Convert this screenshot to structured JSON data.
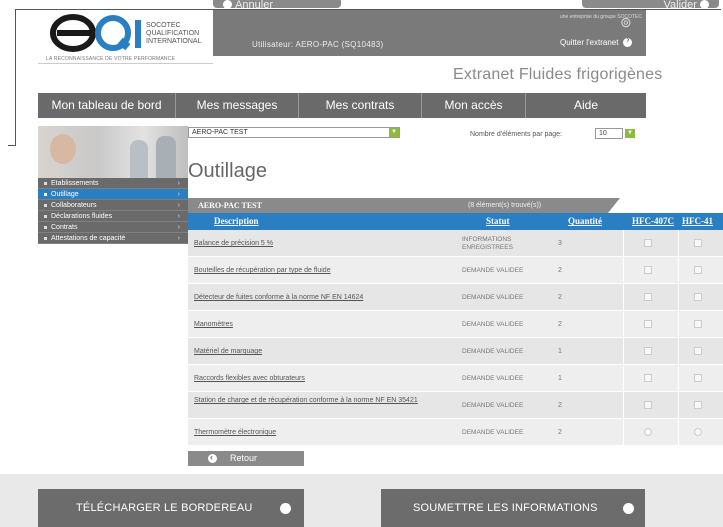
{
  "top_buttons": {
    "cancel_label": "Annuler",
    "validate_label": "Valider"
  },
  "header": {
    "logo_text": [
      "SOCOTEC",
      "QUALIFICATION",
      "INTERNATIONAL"
    ],
    "tagline": "LA RECONNAISSANCE DE VOTRE PERFORMANCE",
    "user_label": "Utilisateur: AERO-PAC (SQ10483)",
    "brand_text": "une entreprise du groupe SOCOTEC",
    "quit_label": "Quitter l'extranet",
    "site_title": "Extranet Fluides frigorigènes"
  },
  "nav": {
    "items": [
      "Mon tableau de bord",
      "Mes messages",
      "Mes contrats",
      "Mon accès",
      "Aide"
    ]
  },
  "sidebar": {
    "items": [
      {
        "label": "Etablissements",
        "active": false
      },
      {
        "label": "Outillage",
        "active": true
      },
      {
        "label": "Collaborateurs",
        "active": false
      },
      {
        "label": "Déclarations fluides",
        "active": false
      },
      {
        "label": "Contrats",
        "active": false
      },
      {
        "label": "Attestations de capacité",
        "active": false
      }
    ]
  },
  "filters": {
    "establishment": "AERO-PAC TEST",
    "per_page_label": "Nombre d'éléments par page:",
    "per_page_value": "10"
  },
  "page_title": "Outillage",
  "table": {
    "group_name": "AERO-PAC TEST",
    "count_text": "(8 élément(s) trouvé(s))",
    "columns": {
      "description": "Description",
      "status": "Statut",
      "quantity": "Quantité",
      "hfc1": "HFC-407C",
      "hfc2": "HFC-41"
    },
    "rows": [
      {
        "description": "Balance de précision 5 %",
        "status": "INFORMATIONS ENREGISTREES",
        "quantity": "3"
      },
      {
        "description": "Bouteilles de récupération par type de fluide",
        "status": "DEMANDE VALIDEE",
        "quantity": "2"
      },
      {
        "description": "Détecteur de fuites conforme à la norme NF EN 14624",
        "status": "DEMANDE VALIDEE",
        "quantity": "2"
      },
      {
        "description": "Manomètres",
        "status": "DEMANDE VALIDEE",
        "quantity": "2"
      },
      {
        "description": "Matériel de marquage",
        "status": "DEMANDE VALIDEE",
        "quantity": "1"
      },
      {
        "description": "Raccords flexibles avec obturateurs",
        "status": "DEMANDE VALIDEE",
        "quantity": "1"
      },
      {
        "description": "Station de charge et de récupération conforme à la norme NF EN 35421",
        "status": "DEMANDE VALIDEE",
        "quantity": "2"
      },
      {
        "description": "Thermomètre électronique",
        "status": "DEMANDE VALIDEE",
        "quantity": "2"
      }
    ]
  },
  "back_label": "Retour",
  "bottom": {
    "download_label": "TÉLÉCHARGER LE BORDEREAU",
    "submit_label": "SOUMETTRE LES INFORMATIONS"
  },
  "colors": {
    "accent_blue": "#2a7ec2",
    "nav_grey": "#6a6a6a",
    "green_dropdown": "#8dbb3f"
  }
}
